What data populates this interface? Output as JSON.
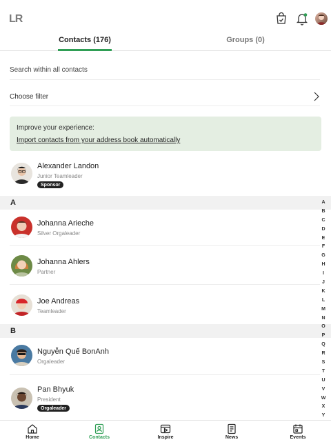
{
  "app": {
    "logo": "LR"
  },
  "header": {
    "icons": [
      "cart-icon",
      "bell-icon",
      "avatar"
    ],
    "notification_color": "#2f9e55"
  },
  "tabs": [
    {
      "label": "Contacts (176)",
      "active": true
    },
    {
      "label": "Groups (0)",
      "active": false
    }
  ],
  "search": {
    "placeholder": "Search within all contacts"
  },
  "filter": {
    "label": "Choose filter"
  },
  "banner": {
    "title": "Improve your experience:",
    "link": "Import contacts from your address book automatically"
  },
  "sponsor": {
    "name": "Alexander Landon",
    "role": "Junior Teamleader",
    "badge": "Sponsor"
  },
  "sections": [
    {
      "letter": "A",
      "contacts": [
        {
          "name": "Johanna Arieche",
          "role": "Silver Orgaleader"
        },
        {
          "name": "Johanna Ahlers",
          "role": "Partner"
        },
        {
          "name": "Joe Andreas",
          "role": "Teamleader"
        }
      ]
    },
    {
      "letter": "B",
      "contacts": [
        {
          "name": "Nguyễn Quế BonAnh",
          "role": "Orgaleader"
        },
        {
          "name": "Pan Bhyuk",
          "role": "President",
          "badge": "Orgaleader"
        }
      ]
    }
  ],
  "alphabet": [
    "A",
    "B",
    "C",
    "D",
    "E",
    "F",
    "G",
    "H",
    "I",
    "J",
    "K",
    "L",
    "M",
    "N",
    "O",
    "P",
    "Q",
    "R",
    "S",
    "T",
    "U",
    "V",
    "W",
    "X",
    "Y"
  ],
  "bottom_nav": [
    {
      "label": "Home",
      "icon": "home-icon",
      "active": false
    },
    {
      "label": "Contacts",
      "icon": "contacts-icon",
      "active": true
    },
    {
      "label": "Inspire",
      "icon": "inspire-icon",
      "active": false
    },
    {
      "label": "News",
      "icon": "news-icon",
      "active": false
    },
    {
      "label": "Events",
      "icon": "events-icon",
      "active": false
    }
  ],
  "colors": {
    "accent": "#2f9e55",
    "banner_bg": "#e4eee2",
    "section_bg": "#f1f1f1"
  }
}
